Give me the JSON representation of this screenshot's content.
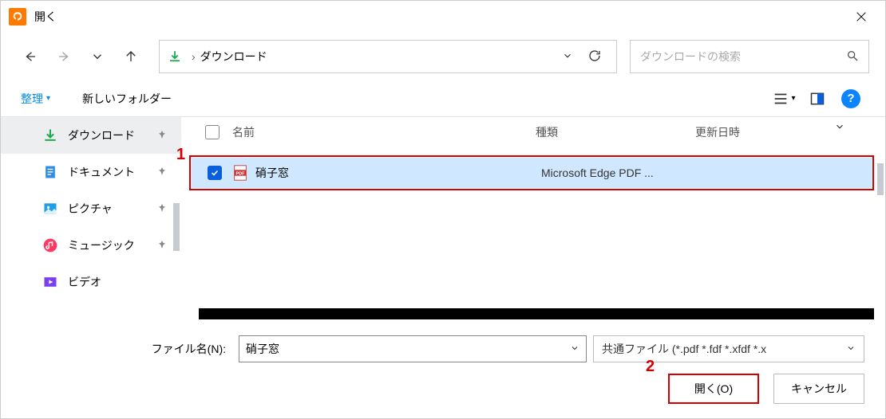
{
  "window": {
    "title": "開く"
  },
  "breadcrumb": {
    "path": "ダウンロード"
  },
  "search": {
    "placeholder": "ダウンロードの検索"
  },
  "toolbar": {
    "organize": "整理",
    "new_folder": "新しいフォルダー"
  },
  "sidebar": {
    "items": [
      {
        "label": "ダウンロード",
        "icon": "download",
        "active": true,
        "pinned": true
      },
      {
        "label": "ドキュメント",
        "icon": "document",
        "active": false,
        "pinned": true
      },
      {
        "label": "ピクチャ",
        "icon": "pictures",
        "active": false,
        "pinned": true
      },
      {
        "label": "ミュージック",
        "icon": "music",
        "active": false,
        "pinned": true
      },
      {
        "label": "ビデオ",
        "icon": "video",
        "active": false,
        "pinned": false
      }
    ]
  },
  "columns": {
    "name": "名前",
    "type": "種類",
    "date": "更新日時"
  },
  "files": [
    {
      "name": "硝子窓",
      "type": "Microsoft Edge PDF ...",
      "date": "",
      "selected": true
    }
  ],
  "footer": {
    "filename_label": "ファイル名(N):",
    "filename_value": "硝子窓",
    "filter_value": "共通ファイル (*.pdf *.fdf *.xfdf *.x",
    "open_button": "開く(O)",
    "cancel_button": "キャンセル"
  },
  "annotations": {
    "one": "1",
    "two": "2"
  }
}
